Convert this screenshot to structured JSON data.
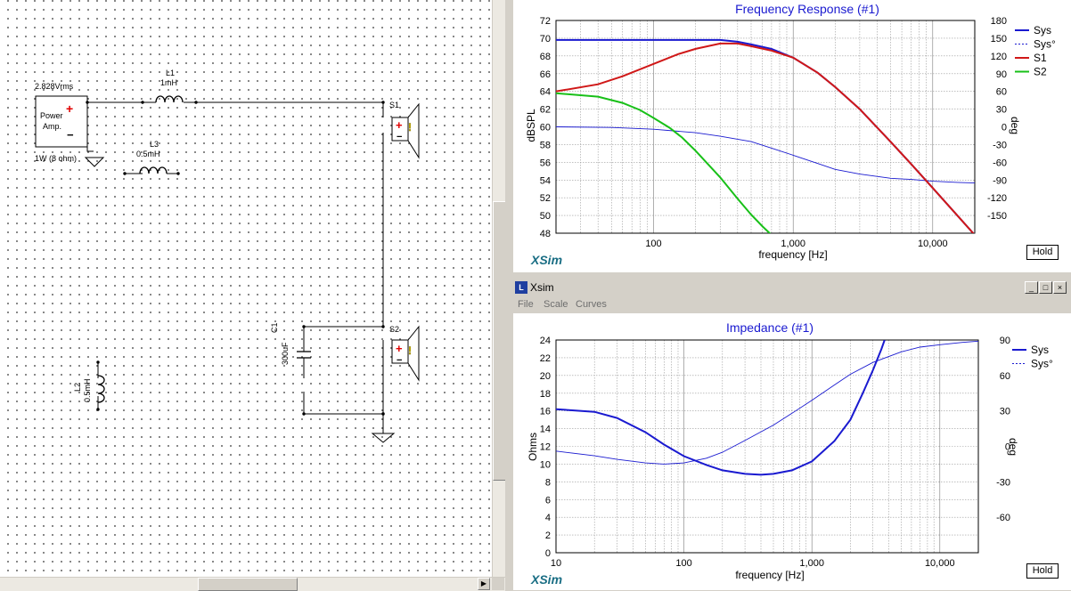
{
  "schematic": {
    "amp_voltage": "2.828Vrms",
    "amp_label_line1": "Power",
    "amp_label_line2": "Amp.",
    "amp_plus": "+",
    "amp_minus": "−",
    "amp_rating": "1W (8 ohm)",
    "l1_name": "L1",
    "l1_value": "1mH",
    "l3_name": "L3",
    "l3_value": "0.5mH",
    "l2_name": "L2",
    "l2_value": "0.5mH",
    "c1_name": "C1",
    "c1_value": "300uF",
    "s1_name": "S1",
    "s2_name": "S2",
    "speaker_plus": "+",
    "speaker_minus": "−",
    "speaker_warn": "!"
  },
  "freq_chart": {
    "title": "Frequency Response (#1)",
    "xlabel": "frequency [Hz]",
    "ylabel_left": "dBSPL",
    "ylabel_right": "deg",
    "x_ticks": [
      "100",
      "1,000",
      "10,000"
    ],
    "y_ticks_left": [
      "72",
      "70",
      "68",
      "66",
      "64",
      "62",
      "60",
      "58",
      "56",
      "54",
      "52",
      "50",
      "48"
    ],
    "y_ticks_right": [
      "180",
      "150",
      "120",
      "90",
      "60",
      "30",
      "0",
      "-30",
      "-60",
      "-90",
      "-120",
      "-150"
    ],
    "legend": [
      "Sys",
      "Sys°",
      "S1",
      "S2"
    ],
    "hold_label": "Hold",
    "logo": "XSim"
  },
  "xsim_window": {
    "title": "Xsim",
    "icon": "L",
    "minimize": "_",
    "maximize": "□",
    "close": "×",
    "menu": [
      "File",
      "Scale",
      "Curves"
    ]
  },
  "imp_chart": {
    "title": "Impedance (#1)",
    "xlabel": "frequency [Hz]",
    "ylabel_left": "Ohms",
    "ylabel_right": "deg",
    "x_ticks": [
      "10",
      "100",
      "1,000",
      "10,000"
    ],
    "y_ticks_left": [
      "24",
      "22",
      "20",
      "18",
      "16",
      "14",
      "12",
      "10",
      "8",
      "6",
      "4",
      "2",
      "0"
    ],
    "y_ticks_right": [
      "90",
      "60",
      "30",
      "0",
      "-30",
      "-60"
    ],
    "legend": [
      "Sys",
      "Sys°"
    ],
    "hold_label": "Hold",
    "logo": "XSim"
  },
  "chart_data": [
    {
      "type": "line",
      "title": "Frequency Response (#1)",
      "xlabel": "frequency [Hz]",
      "ylabel": "dBSPL",
      "y2label": "deg",
      "xscale": "log",
      "xlim": [
        20,
        20000
      ],
      "ylim": [
        48,
        72
      ],
      "y2lim": [
        -180,
        180
      ],
      "grid": true,
      "legend_position": "right",
      "series": [
        {
          "name": "Sys",
          "axis": "left",
          "color": "#1a1ad0",
          "style": "solid",
          "x": [
            20,
            50,
            100,
            200,
            300,
            400,
            500,
            700,
            1000,
            1500,
            2000,
            3000,
            5000,
            7000,
            10000,
            15000,
            20000
          ],
          "y": [
            69.8,
            69.8,
            69.8,
            69.8,
            69.8,
            69.6,
            69.3,
            68.8,
            67.8,
            66.1,
            64.5,
            62.0,
            58.3,
            55.8,
            53.1,
            50.0,
            47.8
          ]
        },
        {
          "name": "Sys°",
          "axis": "right",
          "color": "#1a1ad0",
          "style": "dashed",
          "x": [
            20,
            50,
            100,
            200,
            300,
            500,
            700,
            1000,
            1500,
            2000,
            3000,
            5000,
            7000,
            10000,
            15000,
            20000
          ],
          "y": [
            0,
            -1,
            -4,
            -10,
            -16,
            -25,
            -36,
            -48,
            -62,
            -72,
            -80,
            -87,
            -89,
            -92,
            -94,
            -95
          ]
        },
        {
          "name": "S1",
          "axis": "left",
          "color": "#d01818",
          "style": "solid",
          "x": [
            20,
            40,
            60,
            100,
            150,
            200,
            300,
            400,
            500,
            700,
            1000,
            1500,
            2000,
            3000,
            5000,
            7000,
            10000,
            15000,
            20000
          ],
          "y": [
            64.0,
            64.8,
            65.7,
            67.1,
            68.2,
            68.8,
            69.4,
            69.4,
            69.1,
            68.6,
            67.8,
            66.1,
            64.5,
            62.0,
            58.3,
            55.8,
            53.1,
            50.0,
            47.8
          ]
        },
        {
          "name": "S2",
          "axis": "left",
          "color": "#18c018",
          "style": "solid",
          "x": [
            20,
            40,
            60,
            80,
            100,
            130,
            160,
            200,
            300,
            400,
            500,
            600,
            700
          ],
          "y": [
            63.8,
            63.4,
            62.7,
            61.9,
            61.0,
            59.9,
            58.8,
            57.3,
            54.3,
            51.9,
            50.1,
            48.8,
            47.8
          ]
        }
      ]
    },
    {
      "type": "line",
      "title": "Impedance (#1)",
      "xlabel": "frequency [Hz]",
      "ylabel": "Ohms",
      "y2label": "deg",
      "xscale": "log",
      "xlim": [
        10,
        20000
      ],
      "ylim": [
        0,
        24
      ],
      "y2lim": [
        -90,
        90
      ],
      "grid": true,
      "legend_position": "right",
      "series": [
        {
          "name": "Sys",
          "axis": "left",
          "color": "#1a1ad0",
          "style": "solid",
          "x": [
            10,
            20,
            30,
            50,
            70,
            100,
            150,
            200,
            300,
            400,
            500,
            700,
            1000,
            1500,
            2000,
            2500,
            3000,
            3500,
            3700
          ],
          "y": [
            16.2,
            15.9,
            15.2,
            13.6,
            12.2,
            10.9,
            9.9,
            9.3,
            8.9,
            8.8,
            8.9,
            9.3,
            10.3,
            12.6,
            15.0,
            18.0,
            20.6,
            23.0,
            24.0
          ]
        },
        {
          "name": "Sys°",
          "axis": "right",
          "color": "#1a1ad0",
          "style": "dashed",
          "x": [
            10,
            20,
            30,
            50,
            70,
            100,
            150,
            200,
            300,
            500,
            700,
            1000,
            1500,
            2000,
            3000,
            5000,
            7000,
            10000,
            15000,
            20000
          ],
          "y": [
            -4,
            -8,
            -11,
            -14,
            -15,
            -14,
            -10,
            -5,
            5,
            18,
            28,
            39,
            52,
            61,
            71,
            80,
            84,
            86,
            88,
            89
          ]
        }
      ]
    }
  ]
}
